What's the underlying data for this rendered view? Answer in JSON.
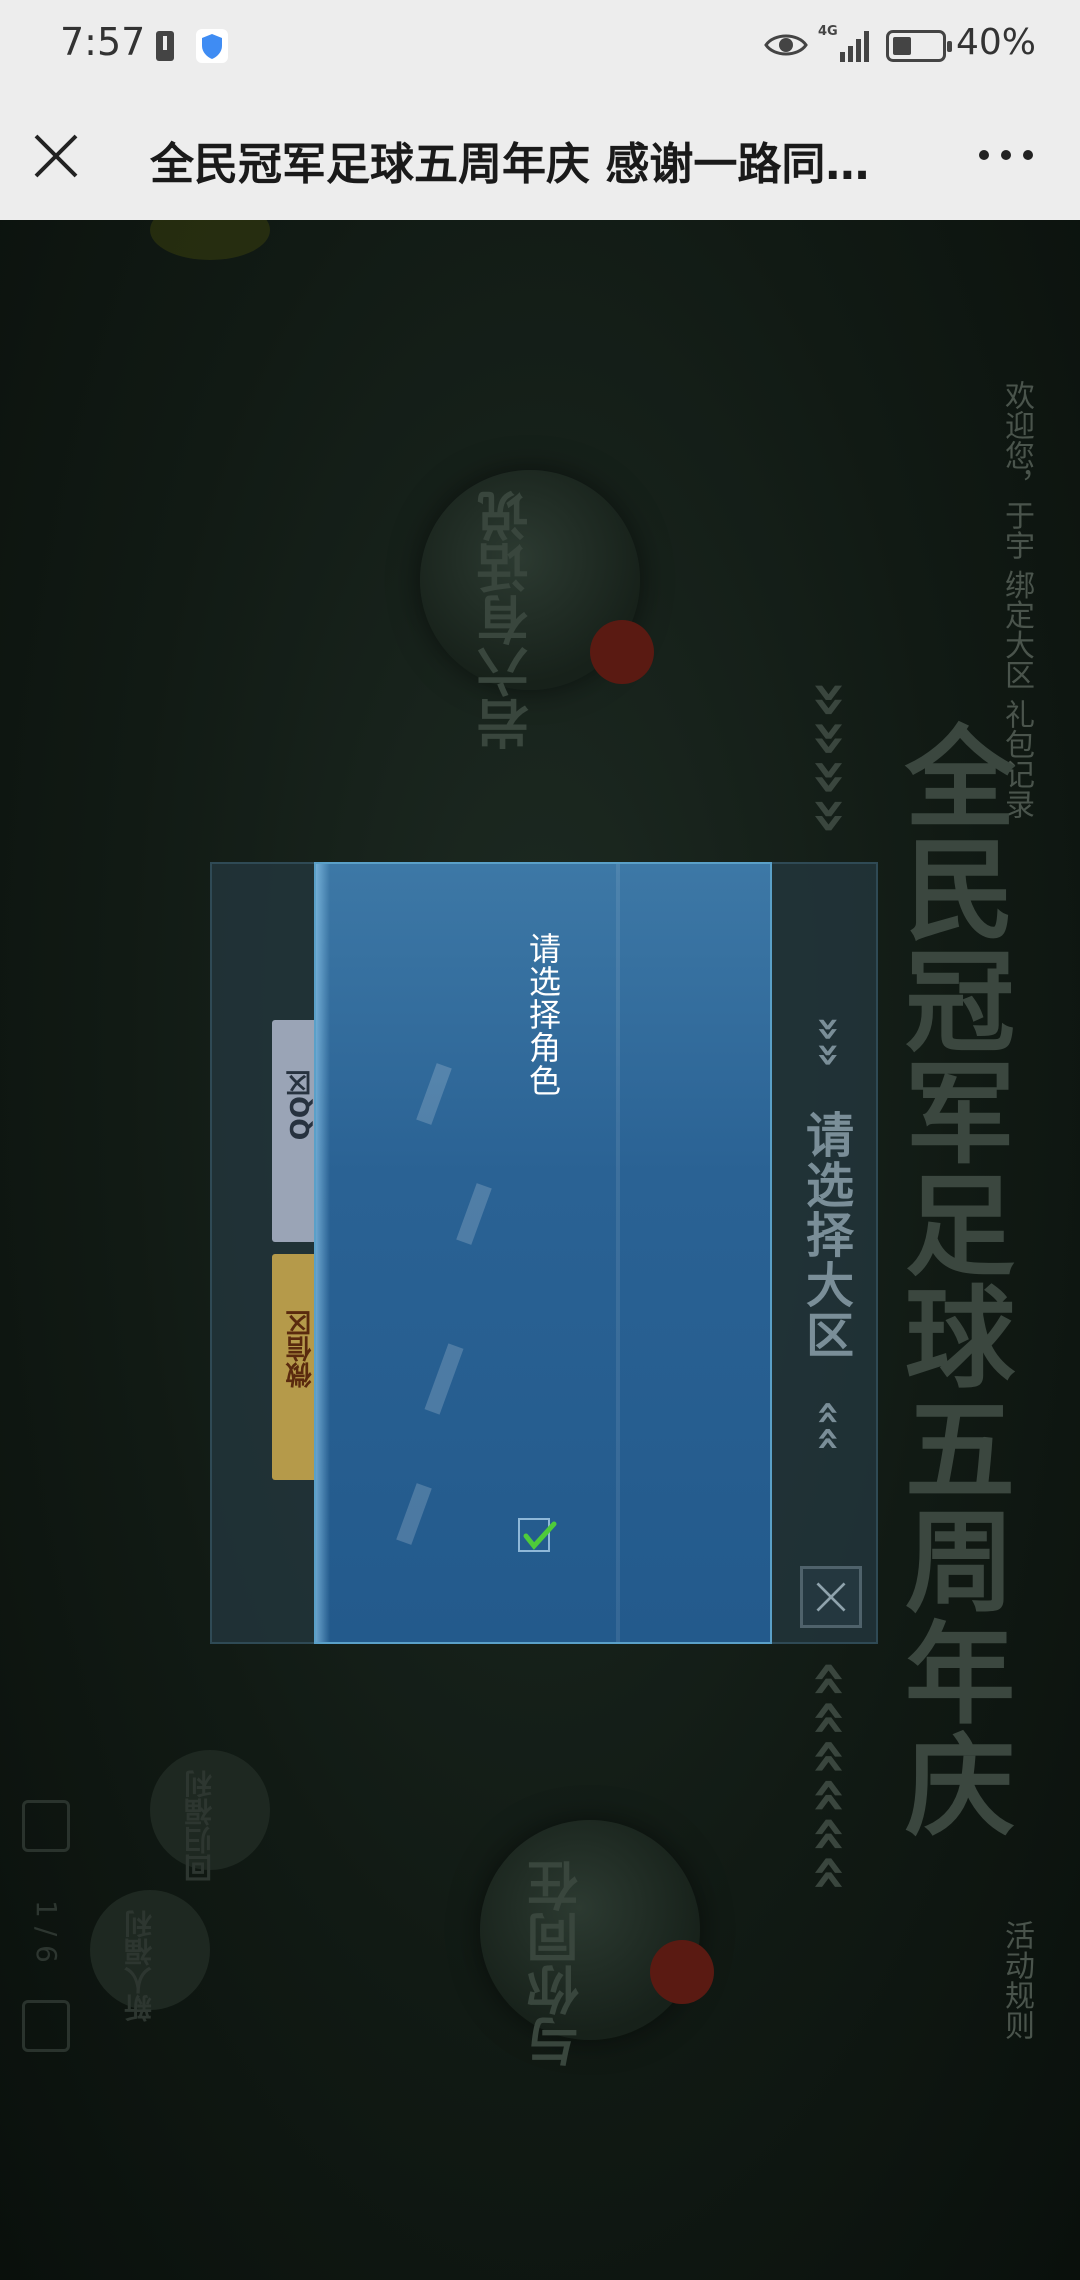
{
  "status_bar": {
    "time": "7:57",
    "network": "4G",
    "battery": "40%"
  },
  "title_bar": {
    "title": "全民冠军足球五周年庆 感谢一路同…"
  },
  "page": {
    "welcome_text": "欢迎您，于宇 绑定大区 礼包记录",
    "big_title": "全民冠军足球五周年庆",
    "bubble_1": "岩六有话说",
    "bubble_2": "与你同在",
    "side_1": "回归福利",
    "side_2": "新人福利",
    "pager": "1 / 6",
    "rules": "活动规则"
  },
  "region_dialog": {
    "title": "请选择大区",
    "arrow_top": "»»",
    "arrow_bottom": "««",
    "server_1": "QQ区",
    "server_2": "微信区"
  },
  "role_dialog": {
    "title": "请选择角色"
  },
  "colors": {
    "accent_blue": "#2a6294",
    "check_green": "#4ecb3a",
    "chrome_bg": "#ededed"
  }
}
